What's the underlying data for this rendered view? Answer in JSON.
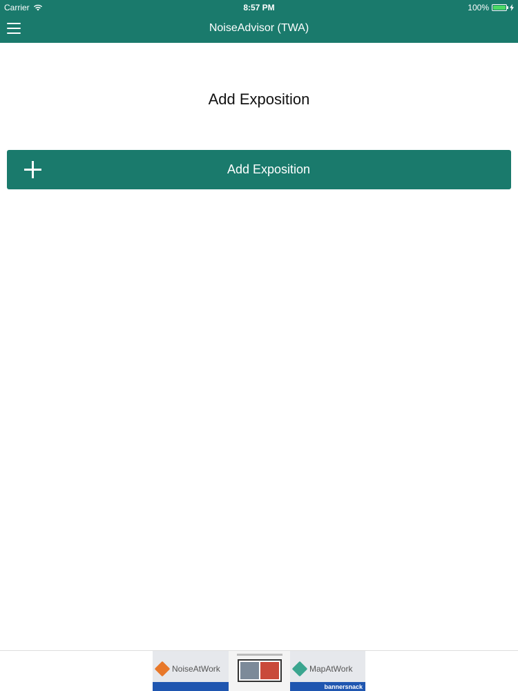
{
  "status_bar": {
    "carrier": "Carrier",
    "time": "8:57 PM",
    "battery_percent": "100%",
    "battery_level": 1.0
  },
  "nav_bar": {
    "title": "NoiseAdvisor (TWA)",
    "menu_icon": "hamburger-menu-icon"
  },
  "main": {
    "heading": "Add Exposition",
    "add_button_label": "Add Exposition",
    "add_button_icon": "plus-icon"
  },
  "ad_banner": {
    "left_brand": "NoiseAtWork",
    "right_brand": "MapAtWork",
    "credit": "bannersnack"
  },
  "colors": {
    "primary": "#1a7a6c",
    "battery": "#4cd964",
    "ad_blue": "#1f56b0"
  }
}
